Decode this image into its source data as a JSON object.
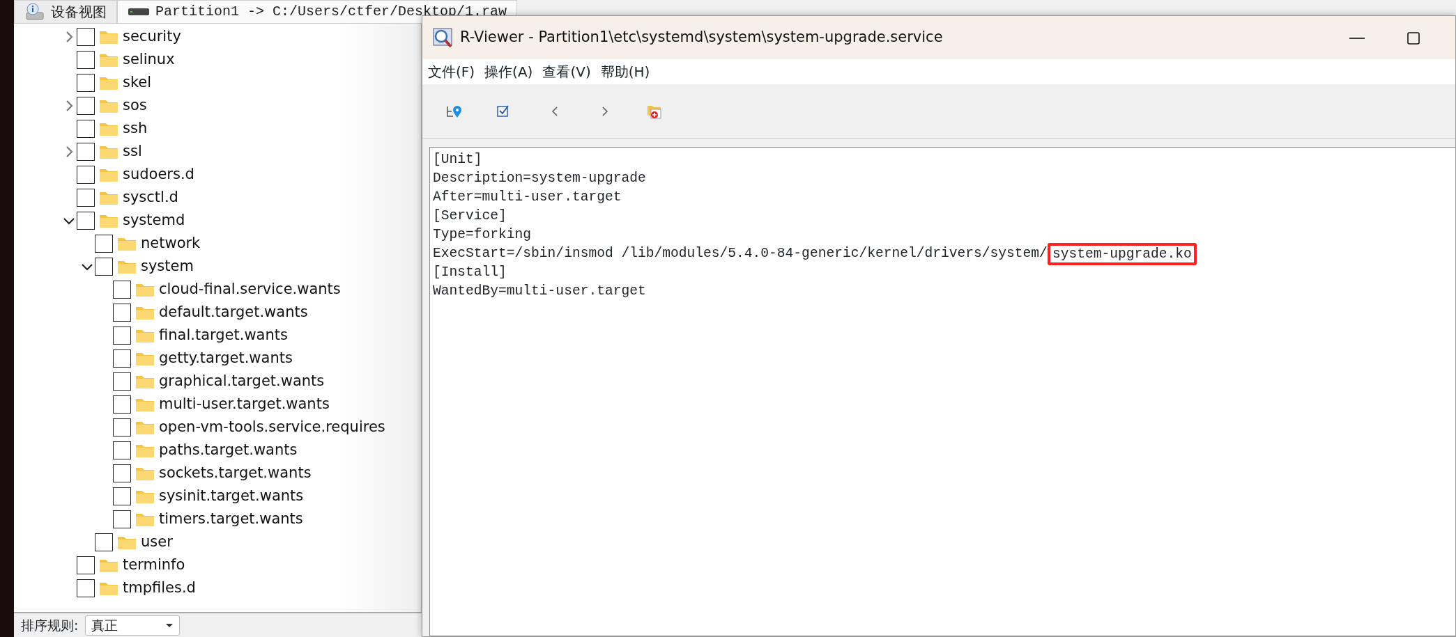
{
  "tabs": [
    {
      "label": "设备视图",
      "kind": "device",
      "selected": false
    },
    {
      "label": "Partition1 -> C:/Users/ctfer/Desktop/1.raw",
      "kind": "drive",
      "selected": true
    }
  ],
  "tree": [
    {
      "label": "security",
      "checked": false,
      "has_children": true,
      "expanded": false
    },
    {
      "label": "selinux",
      "checked": false,
      "has_children": false
    },
    {
      "label": "skel",
      "checked": false,
      "has_children": false
    },
    {
      "label": "sos",
      "checked": false,
      "has_children": true,
      "expanded": false
    },
    {
      "label": "ssh",
      "checked": false,
      "has_children": false
    },
    {
      "label": "ssl",
      "checked": false,
      "has_children": true,
      "expanded": false
    },
    {
      "label": "sudoers.d",
      "checked": false,
      "has_children": false
    },
    {
      "label": "sysctl.d",
      "checked": false,
      "has_children": false
    },
    {
      "label": "systemd",
      "checked": false,
      "has_children": true,
      "expanded": true,
      "children": [
        {
          "label": "network",
          "checked": false,
          "has_children": false
        },
        {
          "label": "system",
          "checked": false,
          "has_children": true,
          "expanded": true,
          "children": [
            {
              "label": "cloud-final.service.wants",
              "checked": false,
              "has_children": false
            },
            {
              "label": "default.target.wants",
              "checked": false,
              "has_children": false
            },
            {
              "label": "final.target.wants",
              "checked": false,
              "has_children": false
            },
            {
              "label": "getty.target.wants",
              "checked": false,
              "has_children": false
            },
            {
              "label": "graphical.target.wants",
              "checked": false,
              "has_children": false
            },
            {
              "label": "multi-user.target.wants",
              "checked": false,
              "has_children": false
            },
            {
              "label": "open-vm-tools.service.requires",
              "checked": false,
              "has_children": false
            },
            {
              "label": "paths.target.wants",
              "checked": false,
              "has_children": false
            },
            {
              "label": "sockets.target.wants",
              "checked": false,
              "has_children": false
            },
            {
              "label": "sysinit.target.wants",
              "checked": false,
              "has_children": false
            },
            {
              "label": "timers.target.wants",
              "checked": false,
              "has_children": false
            }
          ]
        },
        {
          "label": "user",
          "checked": false,
          "has_children": false
        }
      ]
    },
    {
      "label": "terminfo",
      "checked": false,
      "has_children": false
    },
    {
      "label": "tmpfiles.d",
      "checked": false,
      "has_children": false
    }
  ],
  "sort_bar": {
    "label": "排序规则:",
    "value": "真正"
  },
  "viewer": {
    "title": "R-Viewer - Partition1\\etc\\systemd\\system\\system-upgrade.service",
    "menu": [
      "文件(F)",
      "操作(A)",
      "查看(V)",
      "帮助(H)"
    ],
    "lines": [
      {
        "text": "[Unit]"
      },
      {
        "text": "Description=system-upgrade"
      },
      {
        "text": "After=multi-user.target"
      },
      {
        "text": "[Service]"
      },
      {
        "text": "Type=forking"
      },
      {
        "text": "ExecStart=/sbin/insmod /lib/modules/5.4.0-84-generic/kernel/drivers/system/",
        "highlight": "system-upgrade.ko"
      },
      {
        "text": "[Install]"
      },
      {
        "text": "WantedBy=multi-user.target"
      }
    ]
  }
}
